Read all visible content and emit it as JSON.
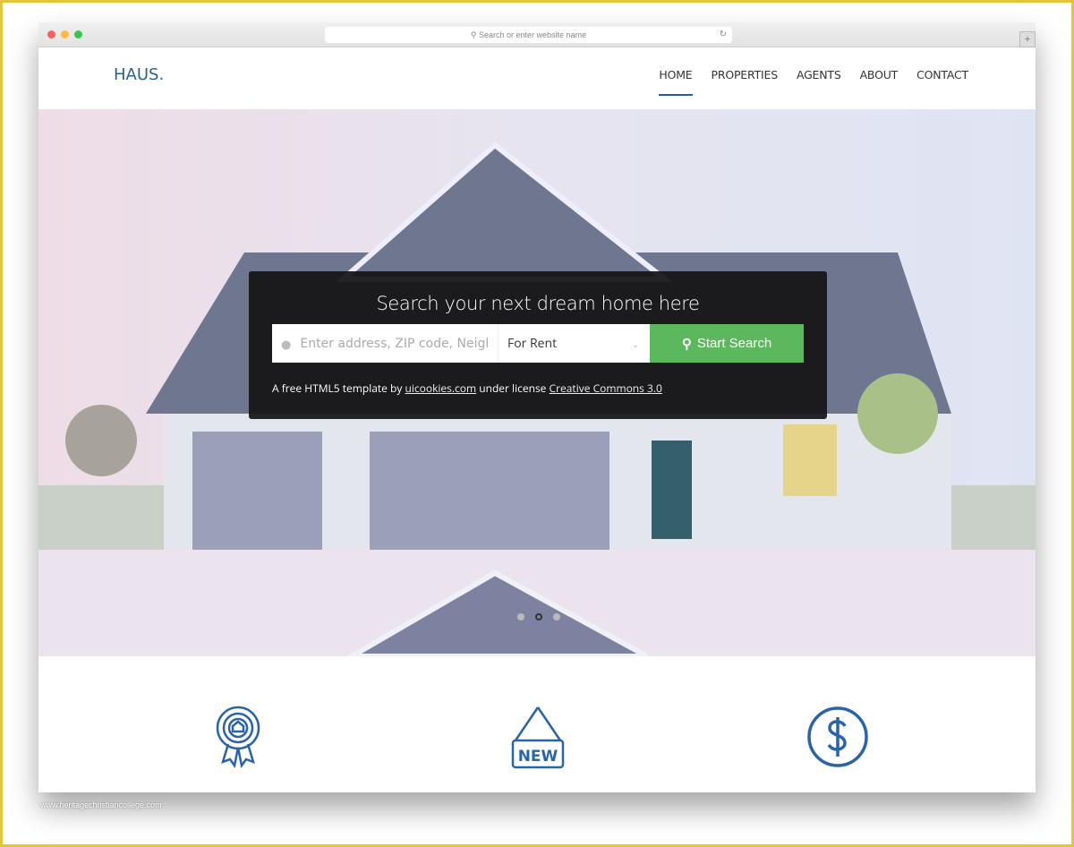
{
  "browser": {
    "url_placeholder": "Search or enter website name"
  },
  "nav": {
    "logo": "HAUS.",
    "items": [
      {
        "label": "HOME",
        "active": true
      },
      {
        "label": "PROPERTIES"
      },
      {
        "label": "AGENTS"
      },
      {
        "label": "ABOUT"
      },
      {
        "label": "CONTACT"
      }
    ]
  },
  "hero": {
    "title": "Search your next dream home here",
    "address_placeholder": "Enter address, ZIP code, Neighborhood",
    "type_selected": "For Rent",
    "search_button": "Start Search",
    "credit_prefix": "A free HTML5 template by",
    "credit_link": "uicookies.com",
    "credit_middle": "under license",
    "license_link": "Creative Commons 3.0",
    "slide_count": 3,
    "active_slide": 2
  },
  "features": {
    "icons": [
      "award-house-icon",
      "new-sign-icon",
      "dollar-icon"
    ]
  },
  "watermark": "www.heritagechristiancollege.com",
  "colors": {
    "brand": "#2a5f95",
    "search_button": "#5cb85c",
    "frame": "#e2c63a"
  }
}
